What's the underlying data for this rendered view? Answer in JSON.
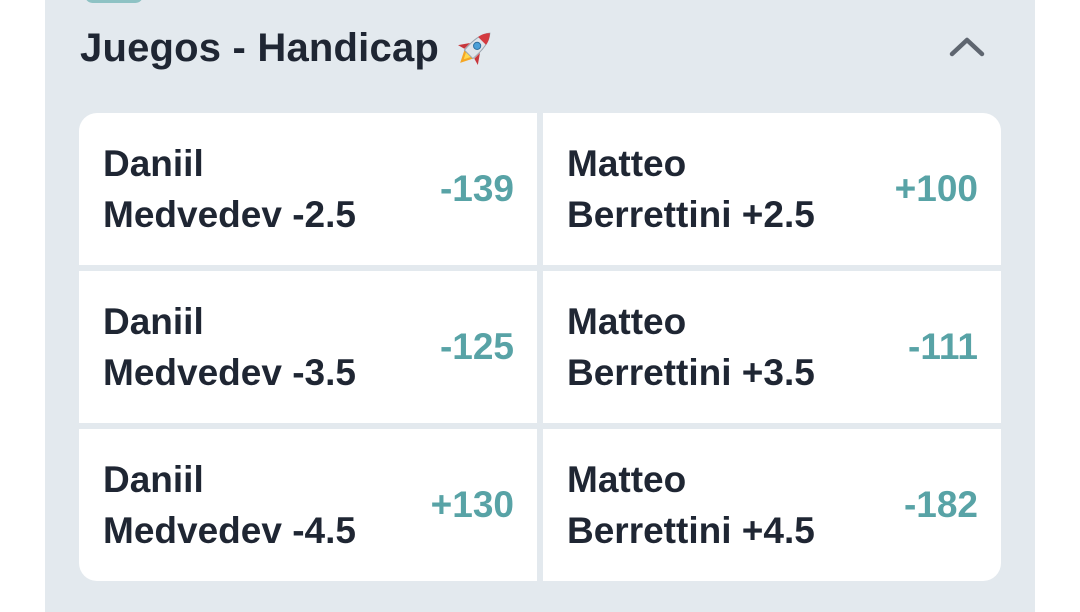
{
  "market": {
    "title": "Juegos - Handicap",
    "title_icon": "rocket-icon",
    "collapse_icon": "chevron-up-icon",
    "accent_color": "#58a3a6",
    "panel_color": "#e3e9ee"
  },
  "selections": [
    {
      "name_line1": "Daniil",
      "name_line2": "Medvedev -2.5",
      "odds": "-139"
    },
    {
      "name_line1": "Matteo",
      "name_line2": "Berrettini +2.5",
      "odds": "+100"
    },
    {
      "name_line1": "Daniil",
      "name_line2": "Medvedev -3.5",
      "odds": "-125"
    },
    {
      "name_line1": "Matteo",
      "name_line2": "Berrettini +3.5",
      "odds": "-111"
    },
    {
      "name_line1": "Daniil",
      "name_line2": "Medvedev -4.5",
      "odds": "+130"
    },
    {
      "name_line1": "Matteo",
      "name_line2": "Berrettini +4.5",
      "odds": "-182"
    }
  ]
}
